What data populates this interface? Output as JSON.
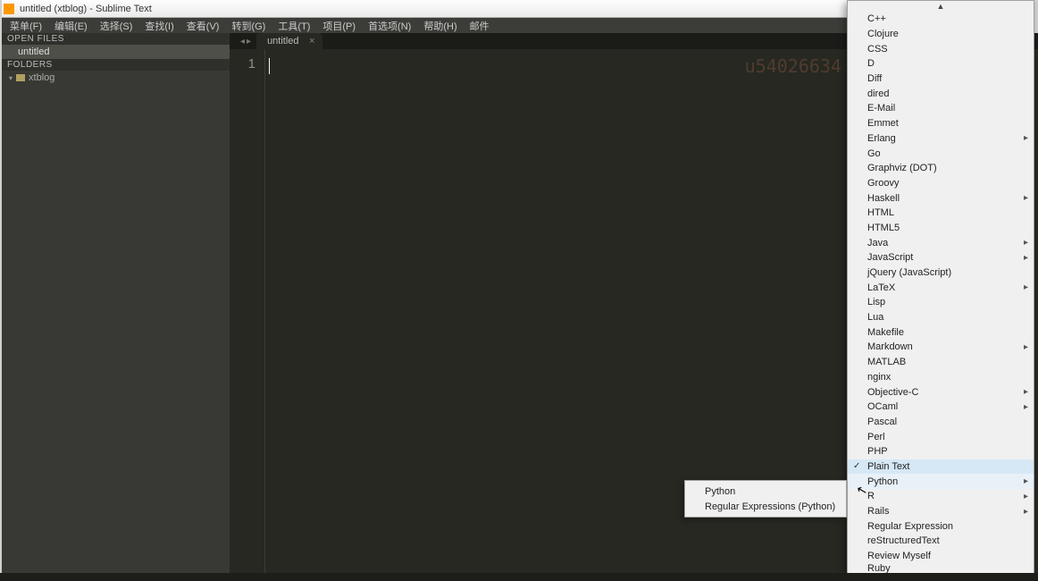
{
  "title": "untitled (xtblog) - Sublime Text",
  "menubar": [
    "菜单(F)",
    "编辑(E)",
    "选择(S)",
    "查找(I)",
    "查看(V)",
    "转到(G)",
    "工具(T)",
    "项目(P)",
    "首选项(N)",
    "帮助(H)",
    "邮件"
  ],
  "sidebar": {
    "open_files_header": "OPEN FILES",
    "open_file": "untitled",
    "folders_header": "FOLDERS",
    "folder_name": "xtblog"
  },
  "tab": {
    "label": "untitled"
  },
  "gutter": {
    "line1": "1"
  },
  "watermark": "u54026634",
  "syntax_menu": {
    "items": [
      {
        "label": "C++",
        "sub": false
      },
      {
        "label": "Clojure",
        "sub": false
      },
      {
        "label": "CSS",
        "sub": false
      },
      {
        "label": "D",
        "sub": false
      },
      {
        "label": "Diff",
        "sub": false
      },
      {
        "label": "dired",
        "sub": false
      },
      {
        "label": "E-Mail",
        "sub": false
      },
      {
        "label": "Emmet",
        "sub": false
      },
      {
        "label": "Erlang",
        "sub": true
      },
      {
        "label": "Go",
        "sub": false
      },
      {
        "label": "Graphviz (DOT)",
        "sub": false
      },
      {
        "label": "Groovy",
        "sub": false
      },
      {
        "label": "Haskell",
        "sub": true
      },
      {
        "label": "HTML",
        "sub": false
      },
      {
        "label": "HTML5",
        "sub": false
      },
      {
        "label": "Java",
        "sub": true
      },
      {
        "label": "JavaScript",
        "sub": true
      },
      {
        "label": "jQuery (JavaScript)",
        "sub": false
      },
      {
        "label": "LaTeX",
        "sub": true
      },
      {
        "label": "Lisp",
        "sub": false
      },
      {
        "label": "Lua",
        "sub": false
      },
      {
        "label": "Makefile",
        "sub": false
      },
      {
        "label": "Markdown",
        "sub": true
      },
      {
        "label": "MATLAB",
        "sub": false
      },
      {
        "label": "nginx",
        "sub": false
      },
      {
        "label": "Objective-C",
        "sub": true
      },
      {
        "label": "OCaml",
        "sub": true
      },
      {
        "label": "Pascal",
        "sub": false
      },
      {
        "label": "Perl",
        "sub": false
      },
      {
        "label": "PHP",
        "sub": false
      },
      {
        "label": "Plain Text",
        "sub": false,
        "checked": true,
        "highlight": true
      },
      {
        "label": "Python",
        "sub": true,
        "cursor": true
      },
      {
        "label": "R",
        "sub": true
      },
      {
        "label": "Rails",
        "sub": true
      },
      {
        "label": "Regular Expression",
        "sub": false
      },
      {
        "label": "reStructuredText",
        "sub": false
      },
      {
        "label": "Review Myself",
        "sub": false
      },
      {
        "label": "Ruby",
        "sub": false,
        "partial": true
      }
    ]
  },
  "python_submenu": {
    "items": [
      "Python",
      "Regular Expressions (Python)"
    ]
  }
}
